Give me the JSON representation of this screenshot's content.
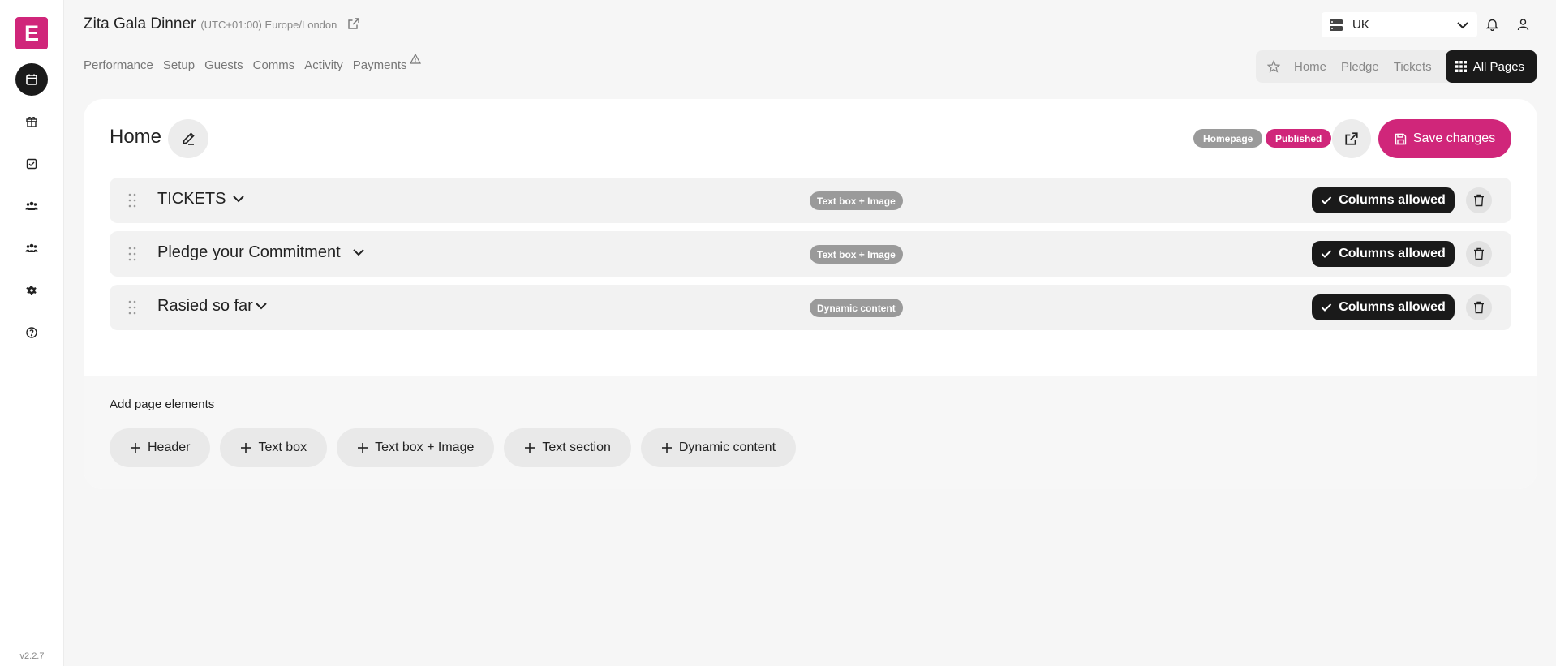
{
  "sidebar": {
    "logo_letter": "E",
    "version": "v2.2.7",
    "items": [
      {
        "name": "calendar-icon",
        "active": true
      },
      {
        "name": "gift-icon"
      },
      {
        "name": "checklist-icon"
      },
      {
        "name": "guests-icon"
      },
      {
        "name": "team-icon"
      },
      {
        "name": "settings-icon"
      },
      {
        "name": "help-icon"
      }
    ]
  },
  "header": {
    "event_name": "Zita Gala Dinner",
    "timezone": "(UTC+01:00) Europe/London",
    "region": "UK",
    "tabs": [
      "Performance",
      "Setup",
      "Guests",
      "Comms",
      "Activity",
      "Payments"
    ],
    "quick_pages": [
      "Home",
      "Pledge",
      "Tickets"
    ],
    "all_pages_label": "All Pages"
  },
  "page": {
    "name": "Home",
    "badges": {
      "homepage": "Homepage",
      "published": "Published"
    },
    "save_label": "Save changes",
    "sections": [
      {
        "title": "TICKETS",
        "type": "Text box + Image",
        "columns_label": "Columns allowed"
      },
      {
        "title": "Pledge your Commitment",
        "type": "Text box + Image",
        "columns_label": "Columns allowed"
      },
      {
        "title": "Rasied so far",
        "type": "Dynamic content",
        "columns_label": "Columns allowed"
      }
    ],
    "add_elements": {
      "title": "Add page elements",
      "buttons": [
        "Header",
        "Text box",
        "Text box + Image",
        "Text section",
        "Dynamic content"
      ]
    }
  },
  "colors": {
    "brand": "#d0267a",
    "dark": "#1a1a1a",
    "badge_grey": "#9a9a9a"
  }
}
